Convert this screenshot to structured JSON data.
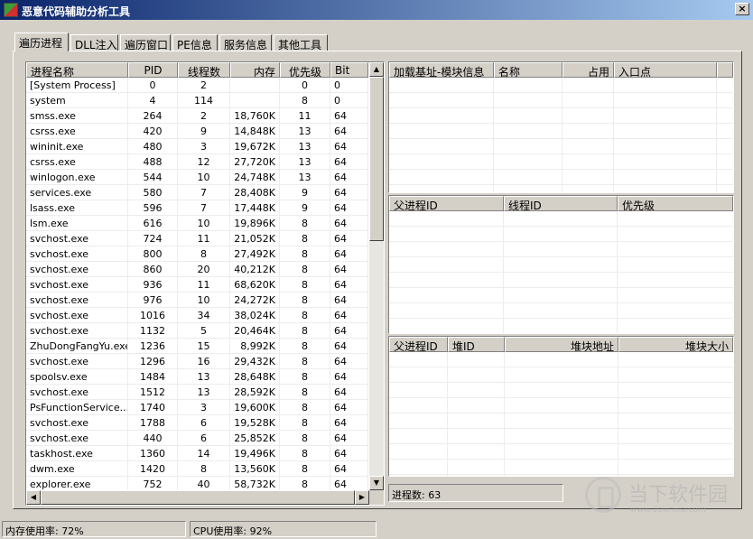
{
  "window": {
    "title": "恶意代码辅助分析工具",
    "close": "×"
  },
  "tabs": [
    "遍历进程",
    "DLL注入",
    "遍历窗口",
    "PE信息",
    "服务信息",
    "其他工具"
  ],
  "process_table": {
    "headers": [
      "进程名称",
      "PID",
      "线程数",
      "内存",
      "优先级",
      "Bit"
    ],
    "rows": [
      [
        "[System Process]",
        "0",
        "2",
        "",
        "0",
        "0"
      ],
      [
        "system",
        "4",
        "114",
        "",
        "8",
        "0"
      ],
      [
        "smss.exe",
        "264",
        "2",
        "18,760K",
        "11",
        "64"
      ],
      [
        "csrss.exe",
        "420",
        "9",
        "14,848K",
        "13",
        "64"
      ],
      [
        "wininit.exe",
        "480",
        "3",
        "19,672K",
        "13",
        "64"
      ],
      [
        "csrss.exe",
        "488",
        "12",
        "27,720K",
        "13",
        "64"
      ],
      [
        "winlogon.exe",
        "544",
        "10",
        "24,748K",
        "13",
        "64"
      ],
      [
        "services.exe",
        "580",
        "7",
        "28,408K",
        "9",
        "64"
      ],
      [
        "lsass.exe",
        "596",
        "7",
        "17,448K",
        "9",
        "64"
      ],
      [
        "lsm.exe",
        "616",
        "10",
        "19,896K",
        "8",
        "64"
      ],
      [
        "svchost.exe",
        "724",
        "11",
        "21,052K",
        "8",
        "64"
      ],
      [
        "svchost.exe",
        "800",
        "8",
        "27,492K",
        "8",
        "64"
      ],
      [
        "svchost.exe",
        "860",
        "20",
        "40,212K",
        "8",
        "64"
      ],
      [
        "svchost.exe",
        "936",
        "11",
        "68,620K",
        "8",
        "64"
      ],
      [
        "svchost.exe",
        "976",
        "10",
        "24,272K",
        "8",
        "64"
      ],
      [
        "svchost.exe",
        "1016",
        "34",
        "38,024K",
        "8",
        "64"
      ],
      [
        "svchost.exe",
        "1132",
        "5",
        "20,464K",
        "8",
        "64"
      ],
      [
        "ZhuDongFangYu.exe",
        "1236",
        "15",
        "8,992K",
        "8",
        "64"
      ],
      [
        "svchost.exe",
        "1296",
        "16",
        "29,432K",
        "8",
        "64"
      ],
      [
        "spoolsv.exe",
        "1484",
        "13",
        "28,648K",
        "8",
        "64"
      ],
      [
        "svchost.exe",
        "1512",
        "13",
        "28,592K",
        "8",
        "64"
      ],
      [
        "PsFunctionService....",
        "1740",
        "3",
        "19,600K",
        "8",
        "64"
      ],
      [
        "svchost.exe",
        "1788",
        "6",
        "19,528K",
        "8",
        "64"
      ],
      [
        "svchost.exe",
        "440",
        "6",
        "25,852K",
        "8",
        "64"
      ],
      [
        "taskhost.exe",
        "1360",
        "14",
        "19,496K",
        "8",
        "64"
      ],
      [
        "dwm.exe",
        "1420",
        "8",
        "13,560K",
        "8",
        "64"
      ],
      [
        "explorer.exe",
        "752",
        "40",
        "58,732K",
        "8",
        "64"
      ]
    ]
  },
  "module_table": {
    "headers": [
      "加载基址-模块信息",
      "名称",
      "占用",
      "入口点"
    ]
  },
  "parent_table": {
    "headers": [
      "父进程ID",
      "线程ID",
      "优先级"
    ]
  },
  "heap_table": {
    "headers": [
      "父进程ID",
      "堆ID",
      "堆块地址",
      "堆块大小"
    ]
  },
  "process_count": "进程数: 63",
  "status": {
    "memory": "内存使用率: 72%",
    "cpu": "CPU使用率: 92%"
  },
  "watermark": {
    "text": "当下软件园",
    "url": "www.downxia.com"
  },
  "icons": {
    "app": "app-icon",
    "up": "up-arrow-icon",
    "down": "down-arrow-icon",
    "left": "left-arrow-icon",
    "right": "right-arrow-icon"
  }
}
